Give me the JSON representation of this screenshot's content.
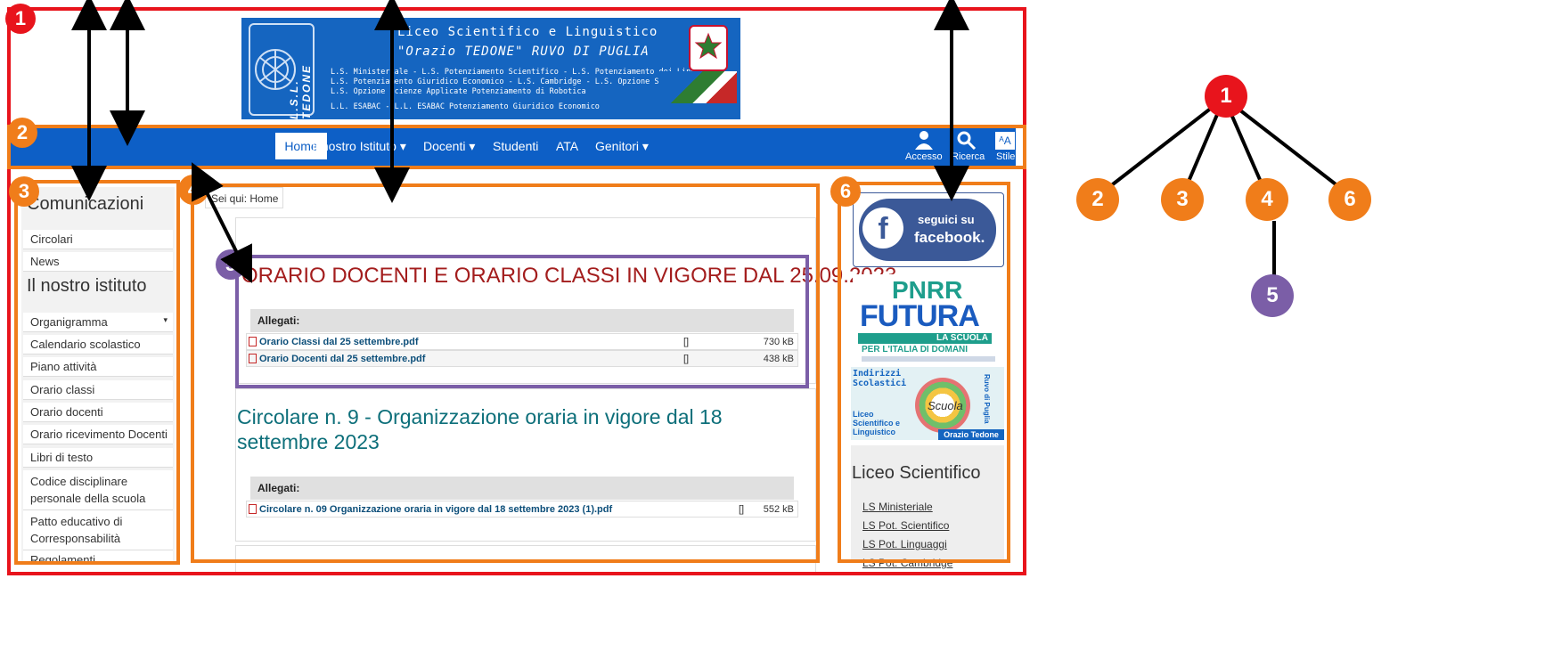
{
  "banner": {
    "vertical_text": "L.S.L. TEDONE",
    "line1": "Liceo Scientifico e Linguistico",
    "line2": "\"Orazio TEDONE\" RUVO DI PUGLIA",
    "small1": "L.S. Ministeriale - L.S. Potenziamento Scientifico - L.S. Potenziamento dei Linguaggi",
    "small2": "L.S. Potenziamento Giuridico Economico - L.S. Cambridge - L.S. Opzione Scienze Applicate",
    "small3": "L.S. Opzione Scienze Applicate Potenziamento di Robotica",
    "small4": "L.L. ESABAC - L.L. ESABAC Potenziamento Giuridico Economico"
  },
  "nav": {
    "items": [
      "Home",
      "Il nostro Istituto",
      "Docenti",
      "Studenti",
      "ATA",
      "Genitori"
    ],
    "icons": [
      {
        "label": "Accesso",
        "icon": "user-icon"
      },
      {
        "label": "Ricerca",
        "icon": "search-icon"
      },
      {
        "label": "Stile",
        "icon": "text-size-icon"
      }
    ]
  },
  "sidebar": {
    "heading1": "Comunicazioni",
    "group1": [
      "Circolari",
      "News"
    ],
    "heading2": "Il nostro istituto",
    "group2": [
      "Organigramma",
      "Calendario scolastico",
      "Piano attività",
      "Orario classi",
      "Orario docenti",
      "Orario ricevimento Docenti",
      "Libri di testo",
      "Codice disciplinare personale della scuola",
      "Patto educativo di Corresponsabilità",
      "Regolamenti"
    ]
  },
  "main": {
    "breadcrumb_prefix": "Sei qui:",
    "breadcrumb": "Home",
    "post1": {
      "title": "ORARIO DOCENTI E ORARIO CLASSI IN VIGORE DAL 25.09.2023",
      "attachments_label": "Allegati:",
      "files": [
        {
          "name": "Orario Classi dal 25 settembre.pdf",
          "hits": "[]",
          "size": "730 kB"
        },
        {
          "name": "Orario Docenti dal 25 settembre.pdf",
          "hits": "[]",
          "size": "438 kB"
        }
      ]
    },
    "post2": {
      "title": "Circolare n. 9 - Organizzazione oraria in vigore dal 18 settembre 2023",
      "attachments_label": "Allegati:",
      "files": [
        {
          "name": "Circolare n. 09 Organizzazione oraria in vigore dal 18 settembre 2023 (1).pdf",
          "hits": "[]",
          "size": "552 kB"
        }
      ]
    }
  },
  "right": {
    "fb_line1": "seguici su",
    "fb_line2": "facebook.",
    "pnrr_line1": "PNRR",
    "pnrr_line2": "FUTURA",
    "pnrr_line3": "LA SCUOLA",
    "pnrr_line4": "PER L'ITALIA DI DOMANI",
    "indirizzi_title": "Indirizzi Scolastici",
    "indirizzi_liceo": "Liceo Scientifico e Linguistico",
    "indirizzi_scuola": "Scuola",
    "indirizzi_tedone": "Orazio Tedone",
    "indirizzi_ruvo": "Ruvo di Puglia",
    "heading": "Liceo Scientifico",
    "links": [
      "LS Ministeriale",
      "LS Pot. Scientifico",
      "LS Pot. Linguaggi",
      "LS Pot. Cambridge"
    ]
  },
  "annotations": {
    "regions": [
      {
        "num": "1",
        "color": "#e8141c"
      },
      {
        "num": "2",
        "color": "#f07d1a"
      },
      {
        "num": "3",
        "color": "#f07d1a"
      },
      {
        "num": "4",
        "color": "#f07d1a"
      },
      {
        "num": "5",
        "color": "#7b5ea7"
      },
      {
        "num": "6",
        "color": "#f07d1a"
      }
    ],
    "tree": {
      "root": "1",
      "children": [
        "2",
        "3",
        "4",
        "6"
      ],
      "grandchild_of_4": "5"
    }
  }
}
